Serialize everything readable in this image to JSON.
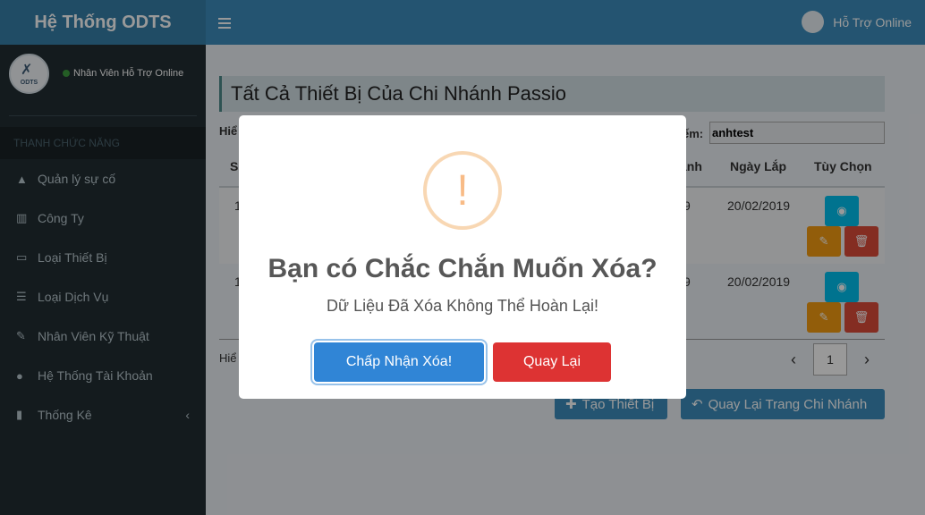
{
  "app": {
    "title": "Hệ Thống ODTS"
  },
  "navbar": {
    "user_label": "Hỗ Trợ Online"
  },
  "sidebar": {
    "avatar_text": "ODTS",
    "user_status": "Nhân Viên Hỗ Trợ Online",
    "menu_header": "THANH CHỨC NĂNG",
    "items": [
      {
        "label": "Quản lý sự cố",
        "icon": "warning-icon"
      },
      {
        "label": "Công Ty",
        "icon": "building-icon"
      },
      {
        "label": "Loại Thiết Bị",
        "icon": "desktop-icon"
      },
      {
        "label": "Loại Dịch Vụ",
        "icon": "list-icon"
      },
      {
        "label": "Nhân Viên Kỹ Thuật",
        "icon": "wrench-icon"
      },
      {
        "label": "Hệ Thống Tài Khoản",
        "icon": "users-icon"
      },
      {
        "label": "Thống Kê",
        "icon": "bar-chart-icon"
      }
    ]
  },
  "page": {
    "title": "Tất Cả Thiết Bị Của Chi Nhánh Passio",
    "show_label_fragment": "Hiể",
    "search_label_fragment": "ếm:",
    "search_value": "anhtest",
    "columns": {
      "stt_fragment": "S",
      "branch_fragment": "ánh",
      "install_date": "Ngày Lắp",
      "options": "Tùy Chọn"
    },
    "rows": [
      {
        "stt_fragment": "1",
        "branch_fragment": "9",
        "install_date": "20/02/2019"
      },
      {
        "stt_fragment": "1",
        "branch_fragment": "9",
        "install_date": "20/02/2019"
      }
    ],
    "footer_fragment": "Hiể",
    "pagination": {
      "current_page": "1"
    },
    "create_button": "Tạo Thiết Bị",
    "back_button": "Quay Lại Trang Chi Nhánh"
  },
  "modal": {
    "icon": "!",
    "title": "Bạn có Chắc Chắn Muốn Xóa?",
    "text": "Dữ Liệu Đã Xóa Không Thể Hoàn Lại!",
    "confirm_label": "Chấp Nhận Xóa!",
    "cancel_label": "Quay Lại"
  }
}
